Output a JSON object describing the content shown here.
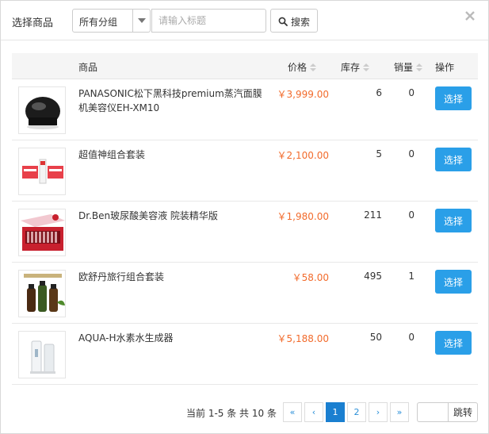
{
  "dialog": {
    "title": "选择商品"
  },
  "filter": {
    "group_selected": "所有分组"
  },
  "search": {
    "placeholder": "请输入标题",
    "button_label": "搜索"
  },
  "table": {
    "columns": {
      "product": "商品",
      "price": "价格",
      "stock": "库存",
      "sales": "销量",
      "action": "操作"
    },
    "rows": [
      {
        "name": "PANASONIC松下黑科技premium蒸汽面膜机美容仪EH-XM10",
        "price": "￥3,999.00",
        "stock": "6",
        "sales": "0",
        "action": "选择"
      },
      {
        "name": "超值神组合套装",
        "price": "￥2,100.00",
        "stock": "5",
        "sales": "0",
        "action": "选择"
      },
      {
        "name": "Dr.Ben玻尿酸美容液 院装精华版",
        "price": "￥1,980.00",
        "stock": "211",
        "sales": "0",
        "action": "选择"
      },
      {
        "name": "欧舒丹旅行组合套装",
        "price": "￥58.00",
        "stock": "495",
        "sales": "1",
        "action": "选择"
      },
      {
        "name": "AQUA-H水素水生成器",
        "price": "￥5,188.00",
        "stock": "50",
        "sales": "0",
        "action": "选择"
      }
    ]
  },
  "pagination": {
    "info": "当前 1-5 条 共 10 条",
    "first": "«",
    "prev": "‹",
    "pages": [
      "1",
      "2"
    ],
    "next": "›",
    "last": "»",
    "jump_label": "跳转"
  },
  "colors": {
    "accent": "#2a9fe8",
    "price": "#f26b2c",
    "active_page": "#1a7fd0"
  }
}
